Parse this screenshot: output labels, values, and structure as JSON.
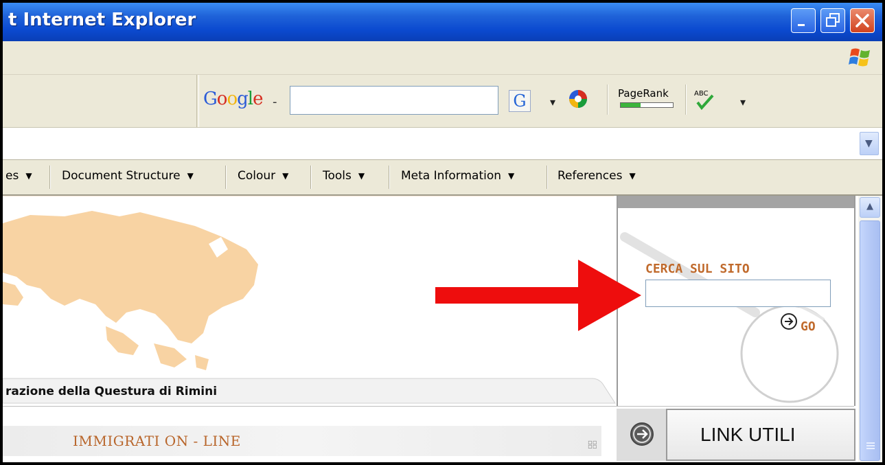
{
  "window": {
    "title": "t Internet Explorer",
    "controls": [
      "minimize-icon",
      "restore-icon",
      "close-icon"
    ]
  },
  "google_toolbar": {
    "logo": [
      "G",
      "o",
      "o",
      "g",
      "l",
      "e"
    ],
    "logo_colors": [
      "#2a5bd7",
      "#d62d20",
      "#f2b50f",
      "#2a5bd7",
      "#1a9d3a",
      "#d62d20"
    ],
    "logo_caret": "-",
    "search_value": "",
    "search_button": "G",
    "pagerank_label": "PageRank",
    "pagerank_fill_fraction": 0.38,
    "spellcheck_label": "ABC"
  },
  "address_bar": {
    "value": ""
  },
  "dev_toolbar": {
    "items": [
      "es",
      "Document Structure",
      "Colour",
      "Tools",
      "Meta Information",
      "References"
    ]
  },
  "content": {
    "banner_text": "razione della Questura di Rimini",
    "section_title": "IMMIGRATI ON - LINE",
    "search": {
      "label": "CERCA SUL SITO",
      "input_value": "",
      "go_label": "GO"
    },
    "link_utili": "LINK UTILI"
  },
  "annotation": {
    "arrow_color": "#ee0d0d"
  },
  "colors": {
    "titlebar": "#0b4ad0",
    "accent_orange": "#c06a2c",
    "map_fill": "#f8d3a3"
  }
}
